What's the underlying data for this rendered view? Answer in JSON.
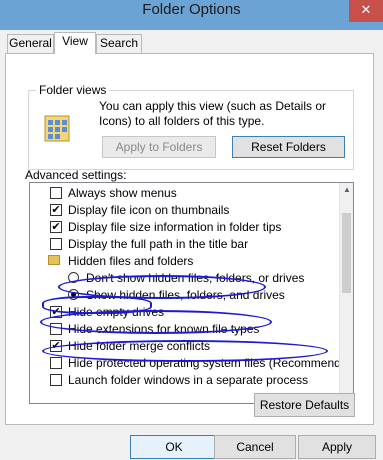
{
  "window": {
    "title": "Folder Options",
    "close_glyph": "✕"
  },
  "tabs": [
    {
      "label": "General",
      "active": false
    },
    {
      "label": "View",
      "active": true
    },
    {
      "label": "Search",
      "active": false
    }
  ],
  "folder_views": {
    "legend": "Folder views",
    "description": "You can apply this view (such as Details or Icons) to all folders of this type.",
    "apply_button": "Apply to Folders",
    "reset_button": "Reset Folders"
  },
  "advanced": {
    "label": "Advanced settings:",
    "items": [
      {
        "type": "checkbox",
        "label": "Always show menus",
        "checked": false
      },
      {
        "type": "checkbox",
        "label": "Display file icon on thumbnails",
        "checked": true
      },
      {
        "type": "checkbox",
        "label": "Display file size information in folder tips",
        "checked": true
      },
      {
        "type": "checkbox",
        "label": "Display the full path in the title bar",
        "checked": false
      },
      {
        "type": "folder",
        "label": "Hidden files and folders"
      },
      {
        "type": "radio",
        "label": "Don't show hidden files, folders, or drives",
        "checked": false
      },
      {
        "type": "radio",
        "label": "Show hidden files, folders, and drives",
        "checked": true
      },
      {
        "type": "checkbox",
        "label": "Hide empty drives",
        "checked": true
      },
      {
        "type": "checkbox",
        "label": "Hide extensions for known file types",
        "checked": false
      },
      {
        "type": "checkbox",
        "label": "Hide folder merge conflicts",
        "checked": true
      },
      {
        "type": "checkbox",
        "label": "Hide protected operating system files (Recommended)",
        "checked": false
      },
      {
        "type": "checkbox",
        "label": "Launch folder windows in a separate process",
        "checked": false
      }
    ]
  },
  "restore_button": "Restore Defaults",
  "footer": {
    "ok": "OK",
    "cancel": "Cancel",
    "apply": "Apply"
  },
  "colors": {
    "titlebar": "#6ba4d4",
    "close": "#c7504b",
    "annotation_ink": "#1b1bd6"
  }
}
